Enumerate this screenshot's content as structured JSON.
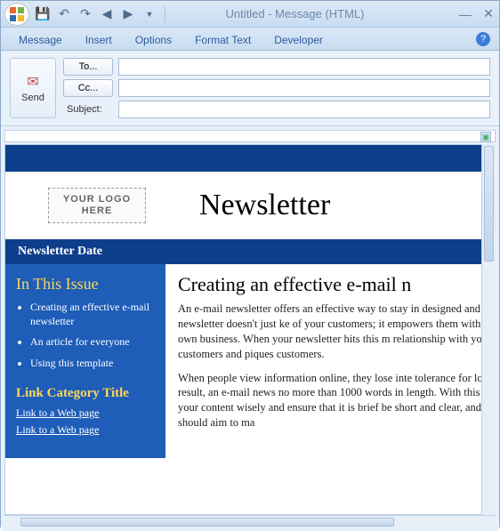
{
  "window": {
    "title": "Untitled - Message (HTML)"
  },
  "ribbon": {
    "tabs": [
      "Message",
      "Insert",
      "Options",
      "Format Text",
      "Developer"
    ]
  },
  "header": {
    "send": "Send",
    "to_btn": "To...",
    "cc_btn": "Cc...",
    "subject_label": "Subject:",
    "to_value": "",
    "cc_value": "",
    "subject_value": ""
  },
  "newsletter": {
    "logo_text": "YOUR LOGO HERE",
    "title": "Newsletter",
    "date_label": "Newsletter Date",
    "sidebar": {
      "issue_heading": "In This Issue",
      "issue_items": [
        "Creating an effective e-mail newsletter",
        "An article for everyone",
        "Using this template"
      ],
      "link_category": "Link Category Title",
      "links": [
        "Link to a Web page",
        "Link to a Web page"
      ]
    },
    "article": {
      "heading": "Creating an effective e-mail n",
      "p1": "An e-mail newsletter offers an effective way to stay in designed and well written newsletter doesn't just ke of your customers; it empowers them with tools and i their own business. When your newsletter hits this m relationship with your existing customers and piques customers.",
      "p2": "When people view information online, they lose inte tolerance for long articles. As a result, an e-mail news no more than 1000 words in length. With this sort of choose your content wisely and ensure that it is brief be short and clear, and each article should aim to ma"
    }
  }
}
